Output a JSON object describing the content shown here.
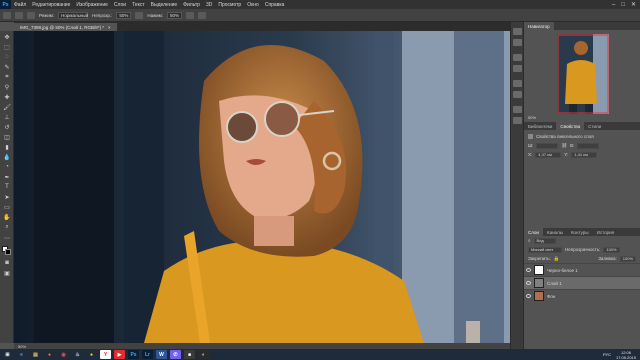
{
  "app": {
    "logo": "Ps"
  },
  "menu": [
    "Файл",
    "Редактирование",
    "Изображение",
    "Слои",
    "Текст",
    "Выделение",
    "Фильтр",
    "3D",
    "Просмотр",
    "Окно",
    "Справка"
  ],
  "window_controls": {
    "minimize": "‒",
    "maximize": "□",
    "close": "✕"
  },
  "options": {
    "mode_label": "Режим:",
    "mode_value": "Нормальный",
    "opacity_label": "Непрозр.:",
    "opacity_value": "50%",
    "flow_label": "Нажим:",
    "flow_value": "50%"
  },
  "document_tab": {
    "title": "IMG_7398.jpg @ 50% (Слой 1, RGB/8*) *",
    "close": "×"
  },
  "status": {
    "zoom": "50%"
  },
  "navigator": {
    "tabs": [
      "Навигатор"
    ],
    "zoom": "50%"
  },
  "properties": {
    "tabs": [
      "Библиотеки",
      "Свойства",
      "Стили"
    ],
    "title": "Свойства пиксельного слоя",
    "w_label": "Ш:",
    "w_value": "",
    "h_label": "В:",
    "h_value": "",
    "x_label": "X:",
    "x_value": "4,37 см",
    "y_label": "Y:",
    "y_value": "1,41 см"
  },
  "layers_panel": {
    "tabs": [
      "Слои",
      "Каналы",
      "Контуры",
      "История"
    ],
    "filter": "Вид",
    "blend": "Мягкий свет",
    "opacity_label": "Непрозрачность:",
    "opacity_value": "100%",
    "lock_label": "Закрепить:",
    "fill_label": "Заливка:",
    "fill_value": "100%",
    "layers": [
      {
        "name": "Черно-белое 1",
        "thumb": "#ffffff",
        "selected": false
      },
      {
        "name": "Слой 1",
        "thumb": "#808080",
        "selected": true
      },
      {
        "name": "Фон",
        "thumb": "#b07050",
        "selected": false
      }
    ]
  },
  "taskbar": {
    "items": [
      {
        "label": "⊞",
        "color": "#ffffff",
        "bg": "transparent"
      },
      {
        "label": "e",
        "color": "#3b9bf0",
        "bg": "transparent"
      },
      {
        "label": "▤",
        "color": "#e8c35a",
        "bg": "transparent"
      },
      {
        "label": "●",
        "color": "#ff7a18",
        "bg": "transparent"
      },
      {
        "label": "◉",
        "color": "#e84b3c",
        "bg": "transparent"
      },
      {
        "label": "♨",
        "color": "#c6d4df",
        "bg": "transparent"
      },
      {
        "label": "●",
        "color": "#ffdd00",
        "bg": "transparent"
      },
      {
        "label": "Y",
        "color": "#ff2222",
        "bg": "#ffffff"
      },
      {
        "label": "▶",
        "color": "#ffffff",
        "bg": "#e52b2b"
      },
      {
        "label": "Ps",
        "color": "#31a8ff",
        "bg": "#0a1f33"
      },
      {
        "label": "Lr",
        "color": "#31a8ff",
        "bg": "#0a1f33"
      },
      {
        "label": "W",
        "color": "#ffffff",
        "bg": "#2b579a"
      },
      {
        "label": "✆",
        "color": "#ffffff",
        "bg": "#7360f2"
      },
      {
        "label": "■",
        "color": "#ffffff",
        "bg": "#3a3a3a"
      },
      {
        "label": "◐",
        "color": "#ffffff",
        "bg": "#2b2b2b"
      }
    ]
  },
  "tray": {
    "lang": "РУС",
    "time": "12:06",
    "date": "17.05.2019"
  }
}
